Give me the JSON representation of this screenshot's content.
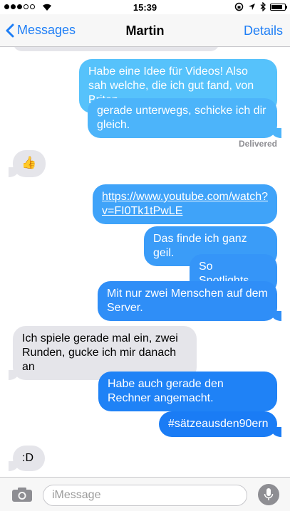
{
  "status_bar": {
    "time": "15:39",
    "signal_bars_filled": 3,
    "signal_bars_total": 5,
    "battery_level": 0.85
  },
  "nav": {
    "back_label": "Messages",
    "title": "Martin",
    "details_label": "Details"
  },
  "messages": [
    {
      "from": "me",
      "text": "Habe eine Idee für Videos! Also sah welche, die ich gut fand, von Briten"
    },
    {
      "from": "me",
      "text": "gerade unterwegs, schicke ich dir gleich."
    },
    {
      "from": "them",
      "text": "👍"
    },
    {
      "from": "me",
      "text": "https://www.youtube.com/watch?v=FI0Tk1tPwLE"
    },
    {
      "from": "me",
      "text": "Das finde ich ganz geil."
    },
    {
      "from": "me",
      "text": "So Spotlights."
    },
    {
      "from": "me",
      "text": "Mit nur zwei Menschen auf dem Server."
    },
    {
      "from": "them",
      "text": "Ich spiele gerade mal ein, zwei Runden, gucke ich mir danach an"
    },
    {
      "from": "me",
      "text": "Habe auch gerade den Rechner angemacht."
    },
    {
      "from": "me",
      "text": "#sätzeausden90ern"
    },
    {
      "from": "them",
      "text": ":D"
    }
  ],
  "delivered_label": "Delivered",
  "input": {
    "placeholder": "iMessage"
  },
  "colors": {
    "bubble_out_light": "#5ac8fa",
    "bubble_out_dark": "#1a7cf5",
    "bubble_in": "#e5e5ea",
    "accent": "#1e7ef6"
  }
}
